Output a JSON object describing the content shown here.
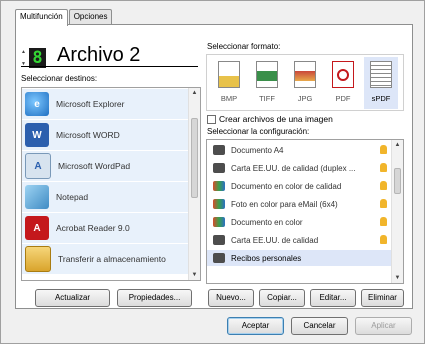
{
  "tabs": [
    {
      "label": "Multifunción"
    },
    {
      "label": "Opciones"
    }
  ],
  "counter": {
    "digit": "8"
  },
  "title": "Archivo 2",
  "destinations": {
    "label": "Seleccionar destinos:",
    "items": [
      {
        "label": "Microsoft Explorer",
        "icon": "internet-explorer-icon"
      },
      {
        "label": "Microsoft WORD",
        "icon": "word-icon"
      },
      {
        "label": "Microsoft WordPad",
        "icon": "wordpad-icon"
      },
      {
        "label": "Notepad",
        "icon": "notepad-icon"
      },
      {
        "label": "Acrobat Reader 9.0",
        "icon": "acrobat-icon"
      },
      {
        "label": "Transferir a almacenamiento",
        "icon": "storage-folder-icon"
      }
    ]
  },
  "formats": {
    "label": "Seleccionar formato:",
    "items": [
      {
        "label": "BMP",
        "icon": "bmp-format-icon"
      },
      {
        "label": "TIFF",
        "icon": "tiff-format-icon"
      },
      {
        "label": "JPG",
        "icon": "jpg-format-icon"
      },
      {
        "label": "PDF",
        "icon": "pdf-format-icon"
      },
      {
        "label": "sPDF",
        "icon": "spdf-format-icon"
      }
    ],
    "selected": "sPDF"
  },
  "create_image_files": {
    "label": "Crear archivos de una imagen",
    "checked": false
  },
  "configs": {
    "label": "Seleccionar la configuración:",
    "items": [
      {
        "label": "Documento A4",
        "icon": "scan-config-icon"
      },
      {
        "label": "Carta EE.UU. de calidad (duplex ...",
        "icon": "scan-config-icon"
      },
      {
        "label": "Documento en color de calidad",
        "icon": "color-config-icon"
      },
      {
        "label": "Foto en color para eMail (6x4)",
        "icon": "color-config-icon"
      },
      {
        "label": "Documento en color",
        "icon": "color-config-icon"
      },
      {
        "label": "Carta EE.UU. de calidad",
        "icon": "scan-config-icon"
      },
      {
        "label": "Recibos personales",
        "icon": "scan-config-icon"
      }
    ]
  },
  "buttons": {
    "refresh": "Actualizar",
    "properties": "Propiedades...",
    "new": "Nuevo...",
    "copy": "Copiar...",
    "edit": "Editar...",
    "delete": "Eliminar",
    "ok": "Aceptar",
    "cancel": "Cancelar",
    "apply": "Aplicar"
  }
}
